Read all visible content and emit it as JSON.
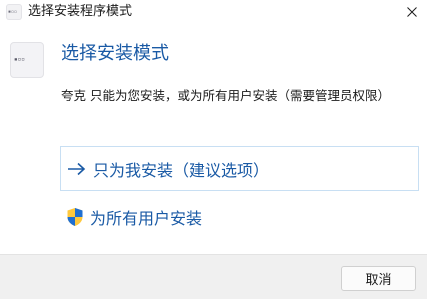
{
  "window": {
    "title": "选择安装程序模式",
    "app_icon": "app-icon",
    "close_icon": "close-icon"
  },
  "header": {
    "heading": "选择安装模式",
    "description": "夸克 只能为您安装，或为所有用户安装（需要管理员权限）"
  },
  "options": {
    "current_user": {
      "label": "只为我安装（建议选项）",
      "icon": "arrow-right-icon"
    },
    "all_users": {
      "label": "为所有用户安装",
      "icon": "uac-shield-icon"
    }
  },
  "footer": {
    "cancel_label": "取消"
  },
  "colors": {
    "accent": "#1a5aa5",
    "footer_bg": "#f0f0f0",
    "option_border": "#c8dff3"
  }
}
